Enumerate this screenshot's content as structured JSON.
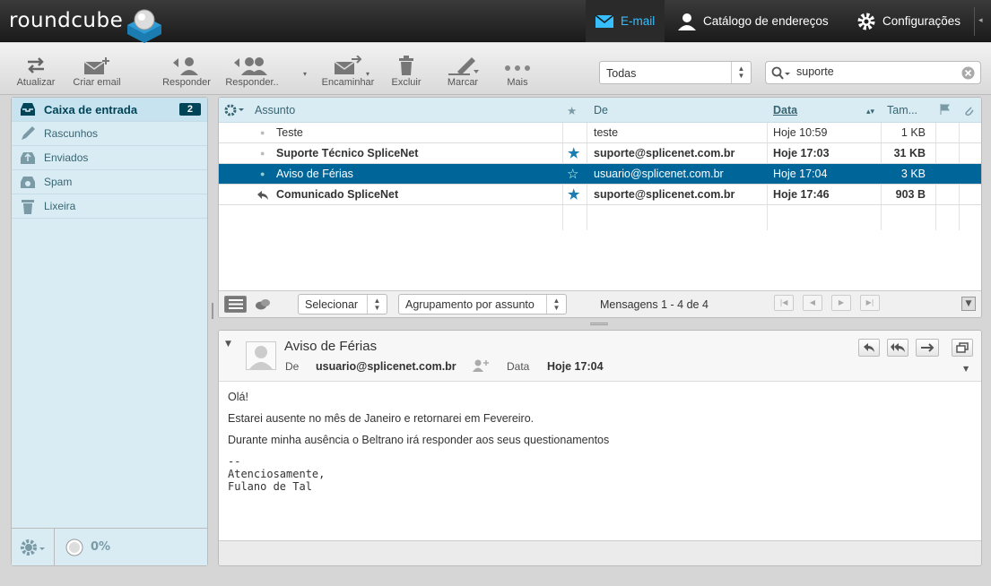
{
  "app": {
    "logo_text": "roundcube"
  },
  "nav": {
    "email": "E-mail",
    "contacts": "Catálogo de endereços",
    "settings": "Configurações"
  },
  "toolbar": {
    "refresh": "Atualizar",
    "compose": "Criar email",
    "reply": "Responder",
    "reply_all": "Responder..",
    "forward": "Encaminhar",
    "delete": "Excluir",
    "mark": "Marcar",
    "more": "Mais"
  },
  "filter": {
    "value": "Todas"
  },
  "search": {
    "value": "suporte"
  },
  "folders": [
    {
      "label": "Caixa de entrada",
      "unread": "2",
      "icon": "inbox-icon"
    },
    {
      "label": "Rascunhos",
      "icon": "pencil-icon"
    },
    {
      "label": "Enviados",
      "icon": "sent-icon"
    },
    {
      "label": "Spam",
      "icon": "spam-icon"
    },
    {
      "label": "Lixeira",
      "icon": "trash-icon"
    }
  ],
  "quota": {
    "text": "0%"
  },
  "list": {
    "headers": {
      "subject": "Assunto",
      "from": "De",
      "date": "Data",
      "size": "Tam..."
    },
    "rows": [
      {
        "subject": "Teste",
        "from": "teste",
        "date": "Hoje 10:59",
        "size": "1 KB",
        "bold": false,
        "flagged": false
      },
      {
        "subject": "Suporte Técnico SpliceNet",
        "from": "suporte@splicenet.com.br",
        "date": "Hoje 17:03",
        "size": "31 KB",
        "bold": true,
        "flagged": true
      },
      {
        "subject": "Aviso de Férias",
        "from": "usuario@splicenet.com.br",
        "date": "Hoje 17:04",
        "size": "3 KB",
        "bold": false,
        "flagged": false,
        "selected": true
      },
      {
        "subject": "Comunicado SpliceNet",
        "from": "suporte@splicenet.com.br",
        "date": "Hoje 17:46",
        "size": "903 B",
        "bold": true,
        "flagged": true,
        "replied": true
      }
    ],
    "select_label": "Selecionar",
    "threads_label": "Agrupamento por assunto",
    "count_text": "Mensagens 1 - 4 de 4"
  },
  "preview": {
    "subject": "Aviso de Férias",
    "from_label": "De",
    "from": "usuario@splicenet.com.br",
    "date_label": "Data",
    "date": "Hoje 17:04",
    "body_lines": [
      "Olá!",
      "Estarei ausente no mês de Janeiro e retornarei em Fevereiro.",
      "Durante minha ausência o Beltrano irá responder aos seus questionamentos"
    ],
    "signature": [
      "--",
      "Atenciosamente,",
      "Fulano de Tal"
    ]
  },
  "colors": {
    "accent": "#37beff",
    "selected_row": "#00669a",
    "sidebar": "#d9ecf4"
  }
}
